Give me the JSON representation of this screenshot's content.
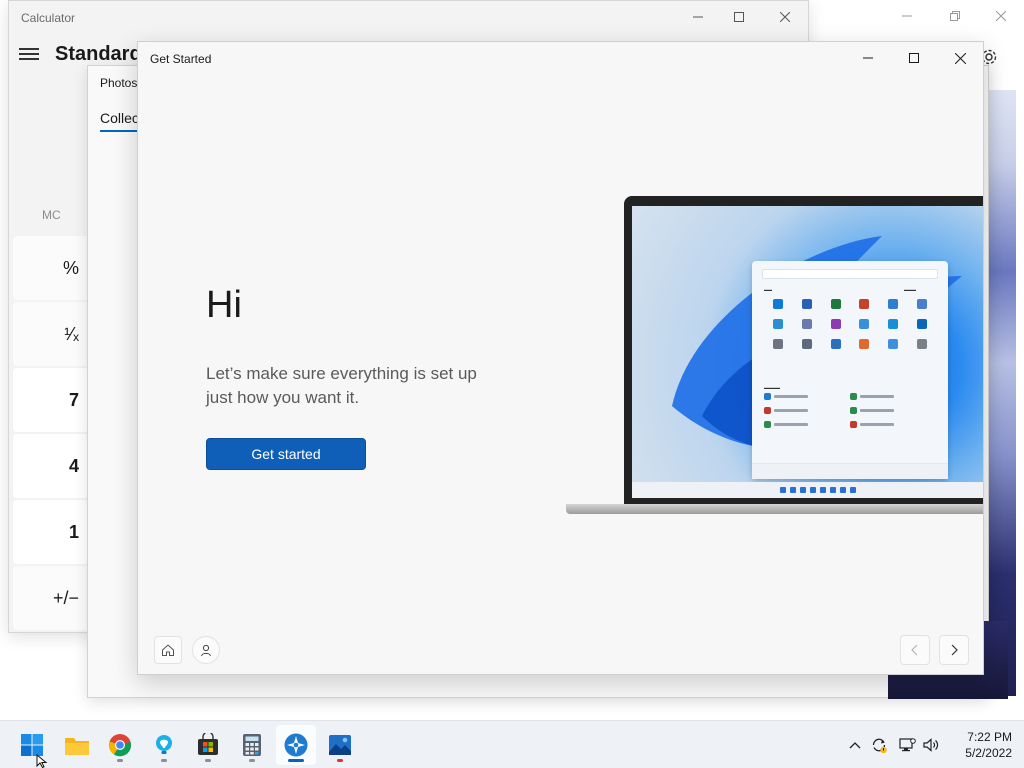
{
  "calculator": {
    "title": "Calculator",
    "mode": "Standard",
    "memory_clear": "MC",
    "keys": [
      "%",
      "¹⁄ₓ",
      "7",
      "4",
      "1",
      "+/−"
    ]
  },
  "photos": {
    "title": "Photos",
    "tab": "Collec"
  },
  "get_started": {
    "title": "Get Started",
    "heading": "Hi",
    "subtitle": "Let’s make sure everything is set up just how you want it.",
    "button_label": "Get started"
  },
  "taskbar": {
    "apps": [
      "start",
      "file-explorer",
      "chrome",
      "tips",
      "microsoft-store",
      "calculator",
      "get-started",
      "photos"
    ],
    "time": "7:22 PM",
    "date": "5/2/2022"
  },
  "colors": {
    "accent": "#0f5fb8",
    "taskbar_indicator": "#0067c0"
  }
}
